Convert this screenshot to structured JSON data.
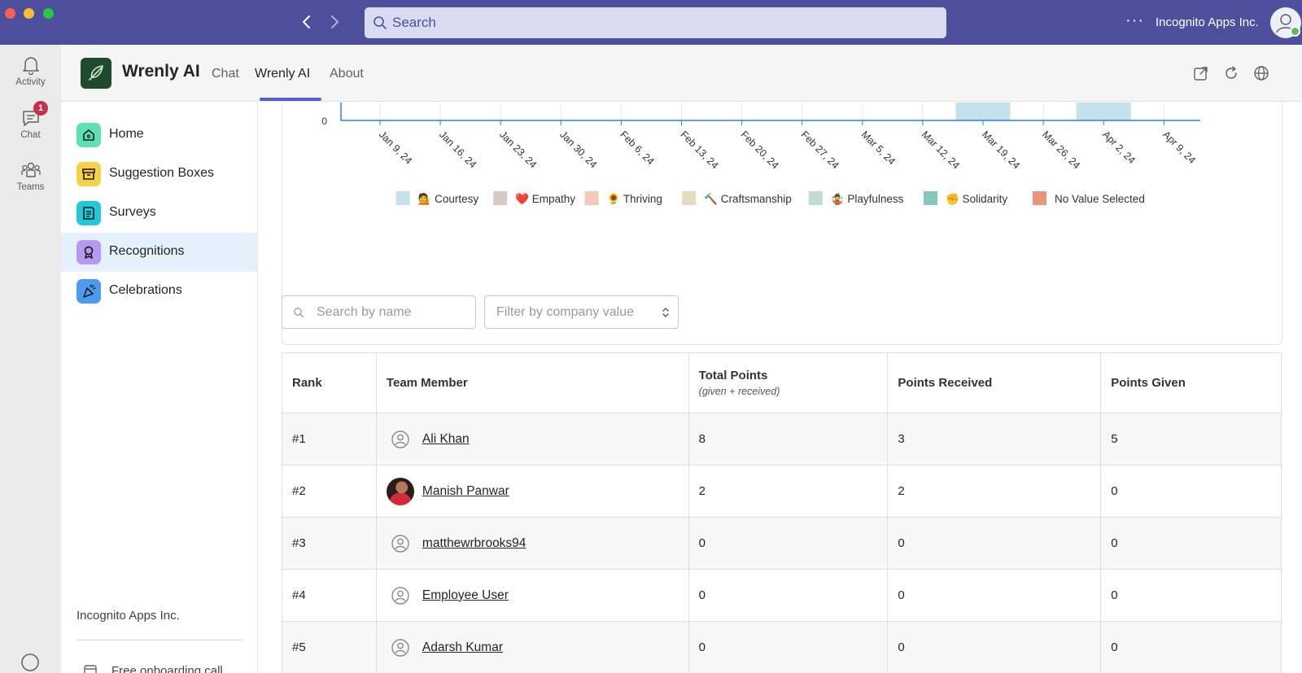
{
  "window": {
    "search_placeholder": "Search",
    "org_name": "Incognito Apps Inc.",
    "more_label": "···"
  },
  "rail": {
    "items": [
      {
        "label": "Activity",
        "icon": "bell-icon"
      },
      {
        "label": "Chat",
        "icon": "chat-icon",
        "badge": "1"
      },
      {
        "label": "Teams",
        "icon": "teams-icon"
      }
    ]
  },
  "app": {
    "title": "Wrenly AI",
    "tabs": [
      {
        "label": "Chat",
        "active": false
      },
      {
        "label": "Wrenly AI",
        "active": true
      },
      {
        "label": "About",
        "active": false
      }
    ]
  },
  "sidebar": {
    "items": [
      {
        "label": "Home",
        "icon": "home-icon",
        "color": "#5ee0b4"
      },
      {
        "label": "Suggestion Boxes",
        "icon": "inbox-icon",
        "color": "#f7d04a"
      },
      {
        "label": "Surveys",
        "icon": "survey-icon",
        "color": "#22c8d8"
      },
      {
        "label": "Recognitions",
        "icon": "award-icon",
        "color": "#b798f0",
        "active": true
      },
      {
        "label": "Celebrations",
        "icon": "party-icon",
        "color": "#4b9cf0"
      }
    ],
    "org_name": "Incognito Apps Inc.",
    "onboarding_label": "Free onboarding call"
  },
  "chart_data": {
    "type": "bar",
    "title": "",
    "xlabel": "",
    "ylabel": "",
    "y_tick_visible": "0",
    "categories": [
      "Jan 9, 24",
      "Jan 16, 24",
      "Jan 23, 24",
      "Jan 30, 24",
      "Feb 6, 24",
      "Feb 13, 24",
      "Feb 20, 24",
      "Feb 27, 24",
      "Mar 5, 24",
      "Mar 12, 24",
      "Mar 19, 24",
      "Mar 26, 24",
      "Apr 2, 24",
      "Apr 9, 24"
    ],
    "stacked": true,
    "bars_visible": [
      {
        "category": "Mar 19, 24",
        "series": "Courtesy"
      },
      {
        "category": "Apr 2, 24",
        "series": "Courtesy"
      }
    ],
    "legend_position": "bottom",
    "legend": [
      {
        "name": "Courtesy",
        "emoji": "💁",
        "color": "#c3e2ec"
      },
      {
        "name": "Empathy",
        "emoji": "❤️",
        "color": "#d9c9c4"
      },
      {
        "name": "Thriving",
        "emoji": "🌻",
        "color": "#f5c8b8"
      },
      {
        "name": "Craftsmanship",
        "emoji": "🔨",
        "color": "#e6dbbf"
      },
      {
        "name": "Playfulness",
        "emoji": "🤹",
        "color": "#c0ddd0"
      },
      {
        "name": "Solidarity",
        "emoji": "✊",
        "color": "#85c7bc"
      },
      {
        "name": "No Value Selected",
        "emoji": "",
        "color": "#e8957a"
      }
    ]
  },
  "filters": {
    "search_placeholder": "Search by name",
    "company_value_placeholder": "Filter by company value"
  },
  "leaderboard": {
    "headers": {
      "rank": "Rank",
      "member": "Team Member",
      "total": "Total Points",
      "total_sub": "(given + received)",
      "received": "Points Received",
      "given": "Points Given"
    },
    "rows": [
      {
        "rank": "#1",
        "name": "Ali Khan",
        "avatar": "default",
        "total": "8",
        "received": "3",
        "given": "5"
      },
      {
        "rank": "#2",
        "name": "Manish Panwar",
        "avatar": "photo",
        "total": "2",
        "received": "2",
        "given": "0"
      },
      {
        "rank": "#3",
        "name": "matthewrbrooks94",
        "avatar": "default",
        "total": "0",
        "received": "0",
        "given": "0"
      },
      {
        "rank": "#4",
        "name": "Employee User",
        "avatar": "default",
        "total": "0",
        "received": "0",
        "given": "0"
      },
      {
        "rank": "#5",
        "name": "Adarsh Kumar",
        "avatar": "default",
        "total": "0",
        "received": "0",
        "given": "0"
      }
    ]
  },
  "colors": {
    "titlebar": "#4b4f9c",
    "accent": "#5b5fc7",
    "axis": "#2f80ed"
  }
}
